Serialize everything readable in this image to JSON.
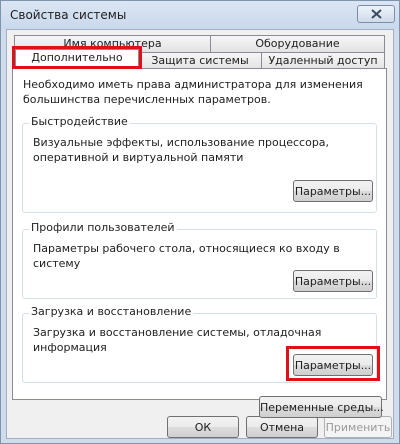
{
  "window": {
    "title": "Свойства системы"
  },
  "tabs": {
    "computer_name": "Имя компьютера",
    "hardware": "Оборудование",
    "advanced": "Дополнительно",
    "system_protection": "Защита системы",
    "remote": "Удаленный доступ"
  },
  "intro": "Необходимо иметь права администратора для изменения большинства перечисленных параметров.",
  "performance": {
    "title": "Быстродействие",
    "description": "Визуальные эффекты, использование процессора, оперативной и виртуальной памяти",
    "button": "Параметры..."
  },
  "user_profiles": {
    "title": "Профили пользователей",
    "description": "Параметры рабочего стола, относящиеся ко входу в систему",
    "button": "Параметры..."
  },
  "startup_recovery": {
    "title": "Загрузка и восстановление",
    "description": "Загрузка и восстановление системы, отладочная информация",
    "button": "Параметры..."
  },
  "env_vars_button": "Переменные среды...",
  "footer": {
    "ok": "ОК",
    "cancel": "Отмена",
    "apply": "Применить"
  },
  "icons": {
    "close": "close-icon"
  }
}
